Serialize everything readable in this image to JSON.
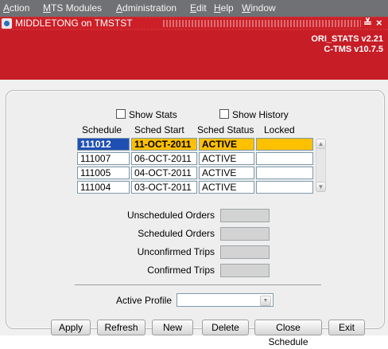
{
  "menu": {
    "items": [
      {
        "prefix": "",
        "underline": "A",
        "rest": "ction"
      },
      {
        "prefix": "",
        "underline": "M",
        "rest": "TS Modules"
      },
      {
        "prefix": "",
        "underline": "A",
        "rest": "dministration"
      },
      {
        "prefix": "",
        "underline": "E",
        "rest": "dit"
      },
      {
        "prefix": "",
        "underline": "H",
        "rest": "elp"
      },
      {
        "prefix": "",
        "underline": "W",
        "rest": "indow"
      }
    ]
  },
  "window": {
    "title": "MIDDLETONG on TMSTST",
    "controls": {
      "minimize": "≚",
      "close": "×"
    }
  },
  "header": {
    "line1": "ORI_STATS v2.21",
    "line2": "C-TMS v10.7.5"
  },
  "checkboxes": {
    "show_stats": "Show Stats",
    "show_history": "Show History"
  },
  "table": {
    "headers": {
      "schedule": "Schedule",
      "start": "Sched Start",
      "status": "Sched Status",
      "locked": "Locked"
    },
    "rows": [
      {
        "schedule": "111012",
        "start": "11-OCT-2011",
        "status": "ACTIVE",
        "locked": ""
      },
      {
        "schedule": "111007",
        "start": "06-OCT-2011",
        "status": "ACTIVE",
        "locked": ""
      },
      {
        "schedule": "111005",
        "start": "04-OCT-2011",
        "status": "ACTIVE",
        "locked": ""
      },
      {
        "schedule": "111004",
        "start": "03-OCT-2011",
        "status": "ACTIVE",
        "locked": ""
      }
    ]
  },
  "stats": {
    "unscheduled_orders": "Unscheduled Orders",
    "scheduled_orders": "Scheduled Orders",
    "unconfirmed_trips": "Unconfirmed Trips",
    "confirmed_trips": "Confirmed Trips"
  },
  "profile": {
    "label": "Active Profile",
    "value": ""
  },
  "buttons": {
    "apply": "Apply",
    "refresh": "Refresh",
    "new": "New",
    "delete": "Delete",
    "close_schedule": "Close Schedule",
    "exit": "Exit"
  },
  "colors": {
    "header_red": "#c61d26",
    "menubar_gray": "#6f7174",
    "selected_row": "#ffc000",
    "selected_cell": "#1f4fb3"
  }
}
